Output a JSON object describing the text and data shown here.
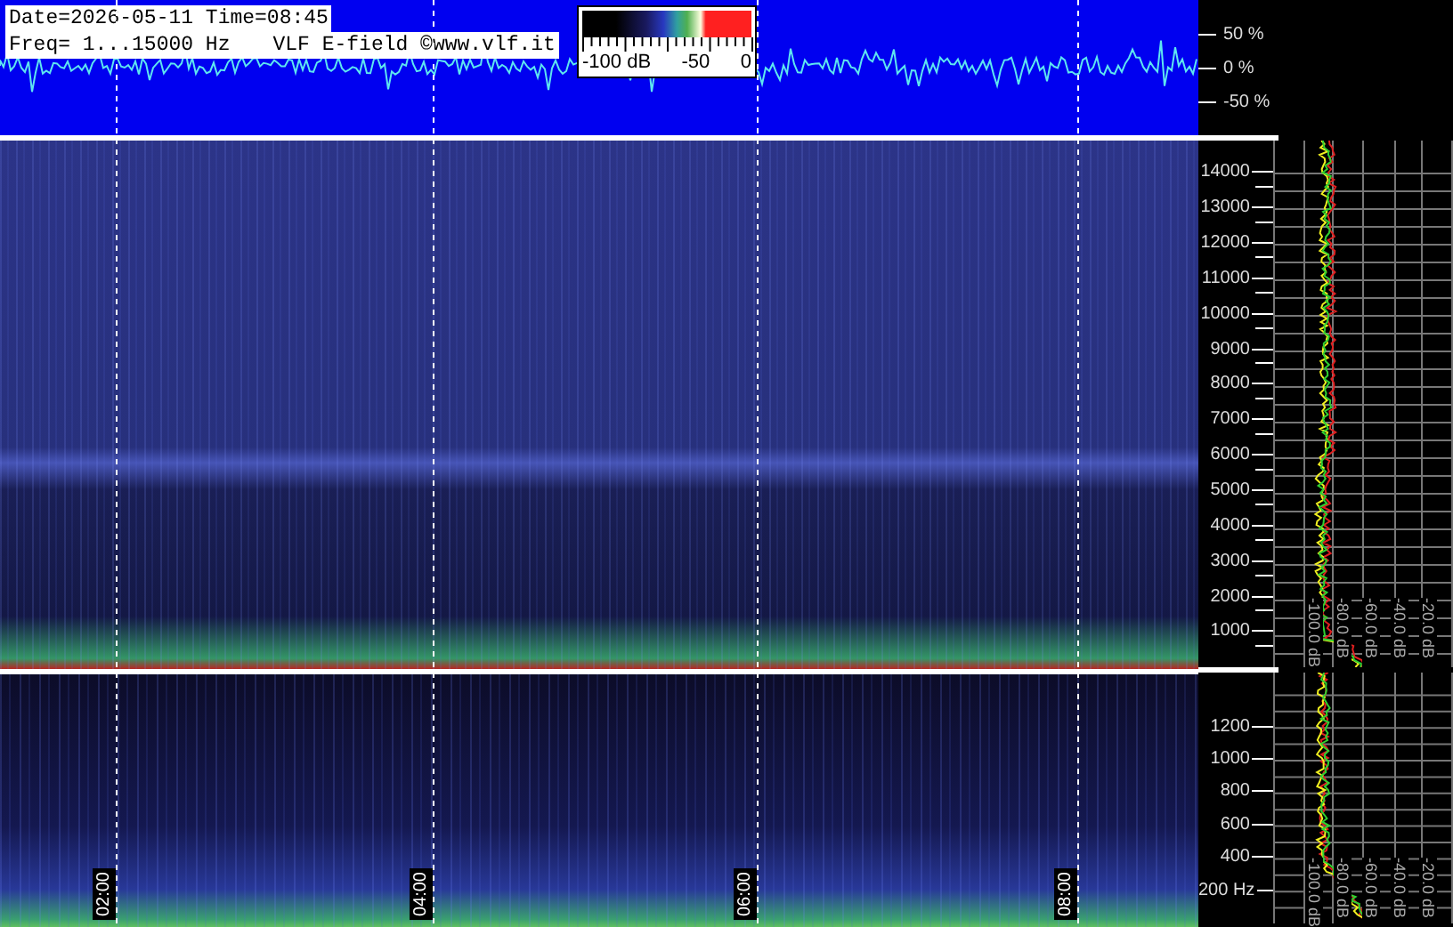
{
  "header": {
    "date_line": "Date=2026-05-11 Time=08:45",
    "freq_line": "Freq= 1...15000 Hz",
    "station": "VLF E-field ©www.vlf.it"
  },
  "colorbar": {
    "labels": [
      "-100 dB",
      "-50",
      "0"
    ]
  },
  "waveform_axis": [
    "50 %",
    "0 %",
    "-50 %"
  ],
  "time_labels": [
    "02:00",
    "04:00",
    "06:00",
    "08:00"
  ],
  "upper_freq_axis": [
    "14000",
    "13000",
    "12000",
    "11000",
    "10000",
    "9000",
    "8000",
    "7000",
    "6000",
    "5000",
    "4000",
    "3000",
    "2000",
    "1000"
  ],
  "upper_db_axis": [
    "-100.0 dB",
    "-80.0 dB",
    "-60.0 dB",
    "-40.0 dB",
    "-20.0 dB"
  ],
  "lower_freq_axis": [
    "1200",
    "1000",
    "800",
    "600",
    "400",
    "200 Hz"
  ],
  "lower_db_axis": [
    "-100.0 dB",
    "-80.0 dB",
    "-60.0 dB",
    "-40.0 dB",
    "-20.0 dB"
  ]
}
